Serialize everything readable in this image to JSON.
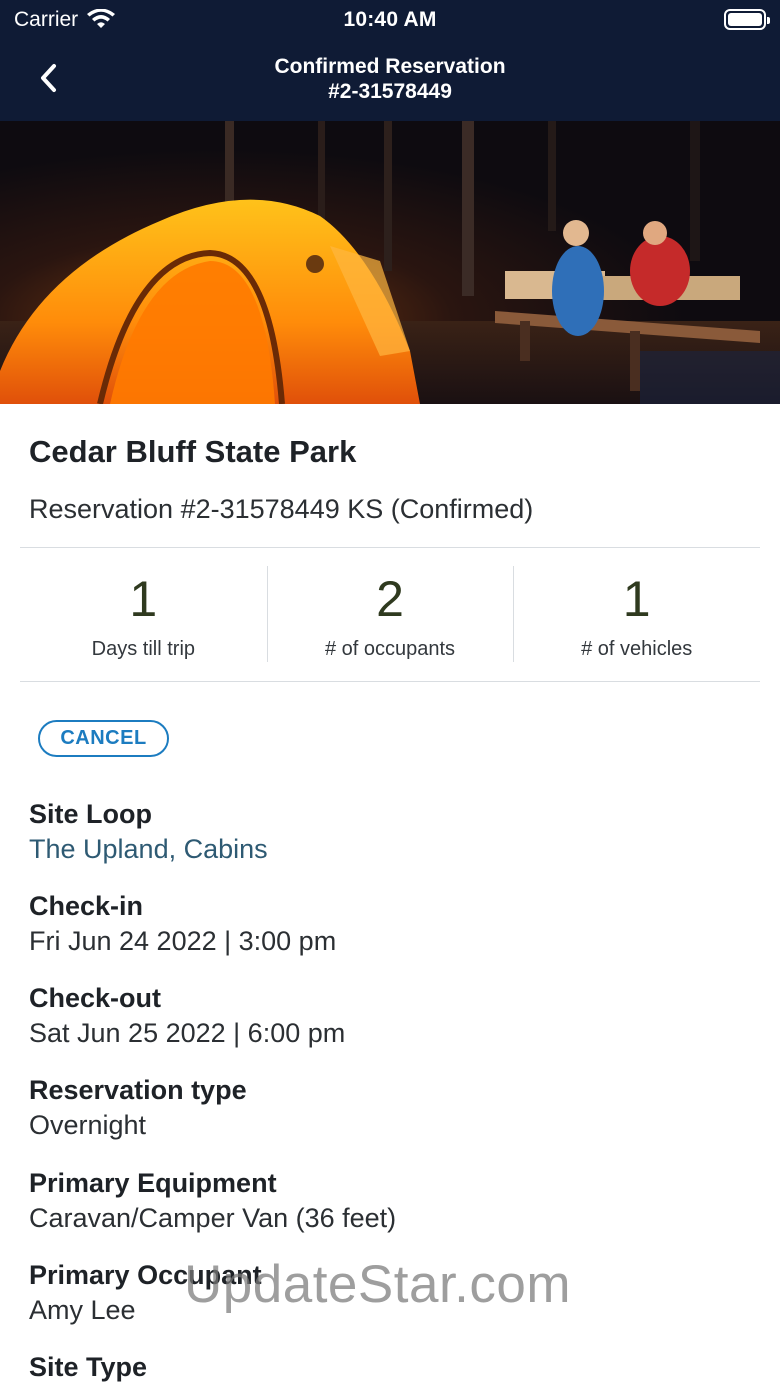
{
  "status_bar": {
    "carrier": "Carrier",
    "time": "10:40 AM"
  },
  "nav": {
    "title_line1": "Confirmed Reservation",
    "title_line2": "#2-31578449"
  },
  "hero": {
    "description": "campsite photo"
  },
  "park": {
    "name": "Cedar Bluff State Park",
    "reservation": "Reservation #2-31578449 KS (Confirmed)"
  },
  "stats": [
    {
      "value": "1",
      "label": "Days till trip"
    },
    {
      "value": "2",
      "label": "# of occupants"
    },
    {
      "value": "1",
      "label": "# of vehicles"
    }
  ],
  "actions": {
    "cancel_label": "CANCEL"
  },
  "details": {
    "site_loop": {
      "label": "Site Loop",
      "value": "The Upland, Cabins"
    },
    "check_in": {
      "label": "Check-in",
      "value": "Fri Jun 24 2022 | 3:00 pm"
    },
    "check_out": {
      "label": "Check-out",
      "value": "Sat Jun 25 2022 | 6:00 pm"
    },
    "reservation_type": {
      "label": "Reservation type",
      "value": "Overnight"
    },
    "primary_equipment": {
      "label": "Primary Equipment",
      "value": "Caravan/Camper Van (36 feet)"
    },
    "primary_occupant": {
      "label": "Primary Occupant",
      "value": "Amy Lee"
    },
    "site_type": {
      "label": "Site Type"
    }
  },
  "watermark": "UpdateStar.com",
  "colors": {
    "header_bg": "#0f1b35",
    "accent": "#1c7cc0",
    "link": "#2e5a73"
  }
}
